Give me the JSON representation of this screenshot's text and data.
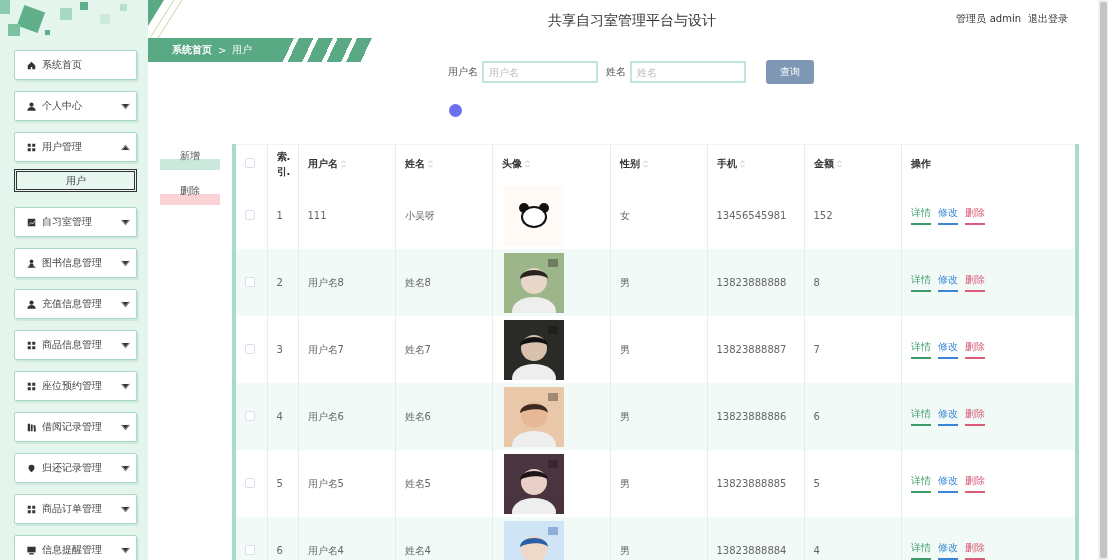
{
  "sidebar": {
    "items": [
      {
        "label": "系统首页",
        "kind": "link"
      },
      {
        "label": "个人中心",
        "kind": "menu",
        "expanded": false
      },
      {
        "label": "用户管理",
        "kind": "menu",
        "expanded": true,
        "children": [
          {
            "label": "用户",
            "selected": true
          }
        ]
      },
      {
        "label": "自习室管理",
        "kind": "menu",
        "expanded": false
      },
      {
        "label": "图书信息管理",
        "kind": "menu",
        "expanded": false
      },
      {
        "label": "充值信息管理",
        "kind": "menu",
        "expanded": false
      },
      {
        "label": "商品信息管理",
        "kind": "menu",
        "expanded": false
      },
      {
        "label": "座位预约管理",
        "kind": "menu",
        "expanded": false
      },
      {
        "label": "借阅记录管理",
        "kind": "menu",
        "expanded": false
      },
      {
        "label": "归还记录管理",
        "kind": "menu",
        "expanded": false
      },
      {
        "label": "商品订单管理",
        "kind": "menu",
        "expanded": false
      },
      {
        "label": "信息提醒管理",
        "kind": "menu",
        "expanded": false
      }
    ]
  },
  "header": {
    "title": "共享自习室管理平台与设计",
    "user": "管理员 admin",
    "logout": "退出登录"
  },
  "breadcrumb": [
    "系统首页",
    ">",
    "用户"
  ],
  "search": {
    "fields": [
      {
        "label": "用户名",
        "placeholder": "用户名"
      },
      {
        "label": "姓名",
        "placeholder": "姓名"
      }
    ],
    "button": "查询"
  },
  "actions": [
    {
      "label": "新增",
      "kind": "add"
    },
    {
      "label": "删除",
      "kind": "delete"
    }
  ],
  "table": {
    "header_checked": false,
    "columns": [
      {
        "label": "索.引.",
        "sortable": false
      },
      {
        "label": "用户名",
        "sortable": true
      },
      {
        "label": "姓名",
        "sortable": true
      },
      {
        "label": "头像",
        "sortable": true
      },
      {
        "label": "性别",
        "sortable": true
      },
      {
        "label": "手机",
        "sortable": true
      },
      {
        "label": "金额",
        "sortable": true
      },
      {
        "label": "操作",
        "sortable": false
      }
    ],
    "rows": [
      {
        "checked": false,
        "cells": [
          "1",
          "111",
          "小吴呀",
          "",
          "女",
          "13456545981",
          "152"
        ],
        "actions": [
          {
            "label": "详情",
            "kind": "detail"
          },
          {
            "label": "修改",
            "kind": "edit"
          },
          {
            "label": "删除",
            "kind": "delete"
          }
        ]
      },
      {
        "checked": false,
        "cells": [
          "2",
          "用户名8",
          "姓名8",
          "",
          "男",
          "13823888888",
          "8"
        ],
        "actions": [
          {
            "label": "详情",
            "kind": "detail"
          },
          {
            "label": "修改",
            "kind": "edit"
          },
          {
            "label": "删除",
            "kind": "delete"
          }
        ]
      },
      {
        "checked": false,
        "cells": [
          "3",
          "用户名7",
          "姓名7",
          "",
          "男",
          "13823888887",
          "7"
        ],
        "actions": [
          {
            "label": "详情",
            "kind": "detail"
          },
          {
            "label": "修改",
            "kind": "edit"
          },
          {
            "label": "删除",
            "kind": "delete"
          }
        ]
      },
      {
        "checked": false,
        "cells": [
          "4",
          "用户名6",
          "姓名6",
          "",
          "男",
          "13823888886",
          "6"
        ],
        "actions": [
          {
            "label": "详情",
            "kind": "detail"
          },
          {
            "label": "修改",
            "kind": "edit"
          },
          {
            "label": "删除",
            "kind": "delete"
          }
        ]
      },
      {
        "checked": false,
        "cells": [
          "5",
          "用户名5",
          "姓名5",
          "",
          "男",
          "13823888885",
          "5"
        ],
        "actions": [
          {
            "label": "详情",
            "kind": "detail"
          },
          {
            "label": "修改",
            "kind": "edit"
          },
          {
            "label": "删除",
            "kind": "delete"
          }
        ]
      },
      {
        "checked": false,
        "cells": [
          "6",
          "用户名4",
          "姓名4",
          "",
          "男",
          "13823888884",
          "4"
        ],
        "actions": [
          {
            "label": "详情",
            "kind": "detail"
          },
          {
            "label": "修改",
            "kind": "edit"
          },
          {
            "label": "删除",
            "kind": "delete"
          }
        ]
      }
    ]
  }
}
